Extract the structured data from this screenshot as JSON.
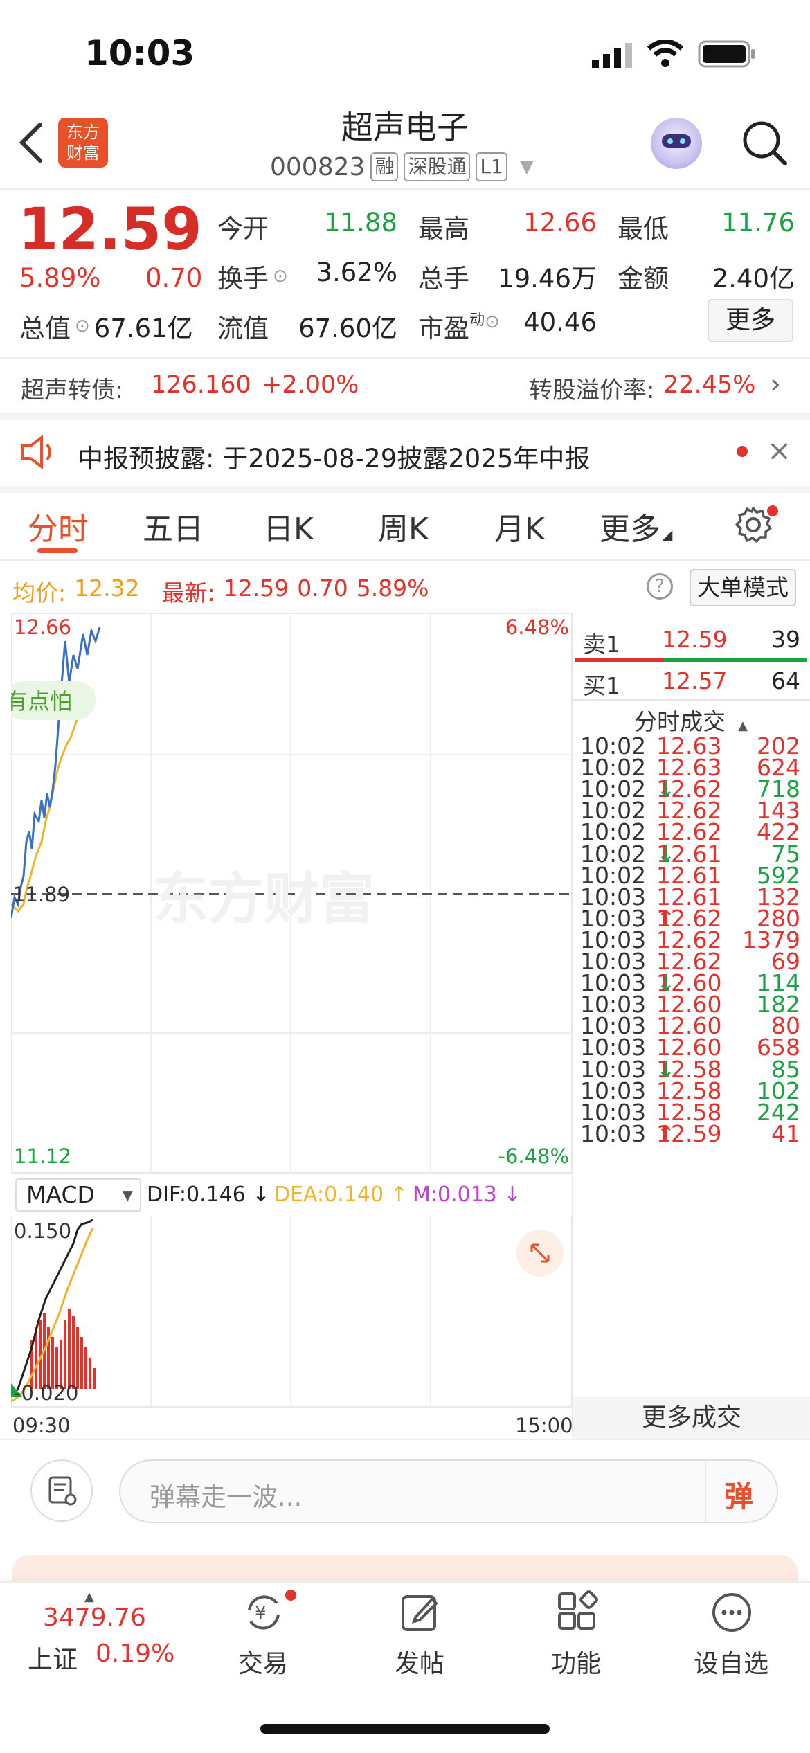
{
  "status_bar": {
    "time": "10:03"
  },
  "header": {
    "title": "超声电子",
    "code": "000823",
    "tags": [
      "融",
      "深股通",
      "L1"
    ],
    "logo_text": [
      "东方",
      "财富"
    ]
  },
  "quote": {
    "price": "12.59",
    "change_pct": "5.89%",
    "change": "0.70",
    "open_label": "今开",
    "open": "11.88",
    "high_label": "最高",
    "high": "12.66",
    "low_label": "最低",
    "low": "11.76",
    "turnover_label": "换手",
    "turnover": "3.62%",
    "volume_label": "总手",
    "volume": "19.46万",
    "amount_label": "金额",
    "amount": "2.40亿",
    "mktcap_label": "总值",
    "mktcap": "67.61亿",
    "float_label": "流值",
    "float": "67.60亿",
    "pe_label": "市盈",
    "pe_sup": "动",
    "pe": "40.46",
    "more": "更多"
  },
  "bond": {
    "label": "超声转债:",
    "price": "126.160",
    "change": "+2.00%",
    "premium_label": "转股溢价率:",
    "premium": "22.45%"
  },
  "notice": {
    "text": "中报预披露: 于2025-08-29披露2025年中报"
  },
  "tabs": [
    "分时",
    "五日",
    "日K",
    "周K",
    "月K",
    "更多"
  ],
  "intraday": {
    "avg_label": "均价:",
    "avg": "12.32",
    "latest_label": "最新:",
    "latest": "12.59",
    "latest_change": "0.70",
    "latest_pct": "5.89%",
    "mode": "大单模式",
    "top_price": "12.66",
    "top_pct": "6.48%",
    "bottom_price": "11.12",
    "bottom_pct": "-6.48%",
    "preclose": "11.89",
    "bubble": "有点怕",
    "watermark": "东方财富",
    "start_time": "09:30",
    "end_time": "15:00"
  },
  "macd": {
    "label": "MACD",
    "dif": "DIF:0.146 ↓",
    "dea": "DEA:0.140 ↑",
    "m": "M:0.013 ↓",
    "top": "0.150",
    "bottom": "-0.020"
  },
  "orderbook": {
    "sell_label": "卖1",
    "sell_price": "12.59",
    "sell_qty": "39",
    "buy_label": "买1",
    "buy_price": "12.57",
    "buy_qty": "64",
    "ticks_title": "分时成交",
    "more_ticks": "更多成交"
  },
  "ticks": [
    {
      "t": "10:02",
      "p": "12.63",
      "a": "",
      "q": "202",
      "c": "red"
    },
    {
      "t": "10:02",
      "p": "12.63",
      "a": "",
      "q": "624",
      "c": "red"
    },
    {
      "t": "10:02",
      "p": "12.62",
      "a": "↓",
      "q": "718",
      "c": "green"
    },
    {
      "t": "10:02",
      "p": "12.62",
      "a": "",
      "q": "143",
      "c": "red"
    },
    {
      "t": "10:02",
      "p": "12.62",
      "a": "",
      "q": "422",
      "c": "red"
    },
    {
      "t": "10:02",
      "p": "12.61",
      "a": "↓",
      "q": "75",
      "c": "green"
    },
    {
      "t": "10:02",
      "p": "12.61",
      "a": "",
      "q": "592",
      "c": "green"
    },
    {
      "t": "10:03",
      "p": "12.61",
      "a": "",
      "q": "132",
      "c": "red"
    },
    {
      "t": "10:03",
      "p": "12.62",
      "a": "↑",
      "q": "280",
      "c": "red"
    },
    {
      "t": "10:03",
      "p": "12.62",
      "a": "",
      "q": "1379",
      "c": "red"
    },
    {
      "t": "10:03",
      "p": "12.62",
      "a": "",
      "q": "69",
      "c": "red"
    },
    {
      "t": "10:03",
      "p": "12.60",
      "a": "↓",
      "q": "114",
      "c": "green"
    },
    {
      "t": "10:03",
      "p": "12.60",
      "a": "",
      "q": "182",
      "c": "green"
    },
    {
      "t": "10:03",
      "p": "12.60",
      "a": "",
      "q": "80",
      "c": "red"
    },
    {
      "t": "10:03",
      "p": "12.60",
      "a": "",
      "q": "658",
      "c": "red"
    },
    {
      "t": "10:03",
      "p": "12.58",
      "a": "↓",
      "q": "85",
      "c": "green"
    },
    {
      "t": "10:03",
      "p": "12.58",
      "a": "",
      "q": "102",
      "c": "green"
    },
    {
      "t": "10:03",
      "p": "12.58",
      "a": "",
      "q": "242",
      "c": "green"
    },
    {
      "t": "10:03",
      "p": "12.59",
      "a": "↑",
      "q": "41",
      "c": "red"
    }
  ],
  "comment": {
    "placeholder": "弹幕走一波...",
    "send": "弹"
  },
  "bottom_nav": {
    "index_value": "3479.76",
    "index_name": "上证",
    "index_pct": "0.19%",
    "items": [
      "交易",
      "发帖",
      "功能",
      "设自选"
    ]
  },
  "colors": {
    "up": "#e3322b",
    "down": "#1aa342",
    "accent": "#e8522a",
    "price_line": "#3a6fc4",
    "avg_line": "#f0b429"
  }
}
